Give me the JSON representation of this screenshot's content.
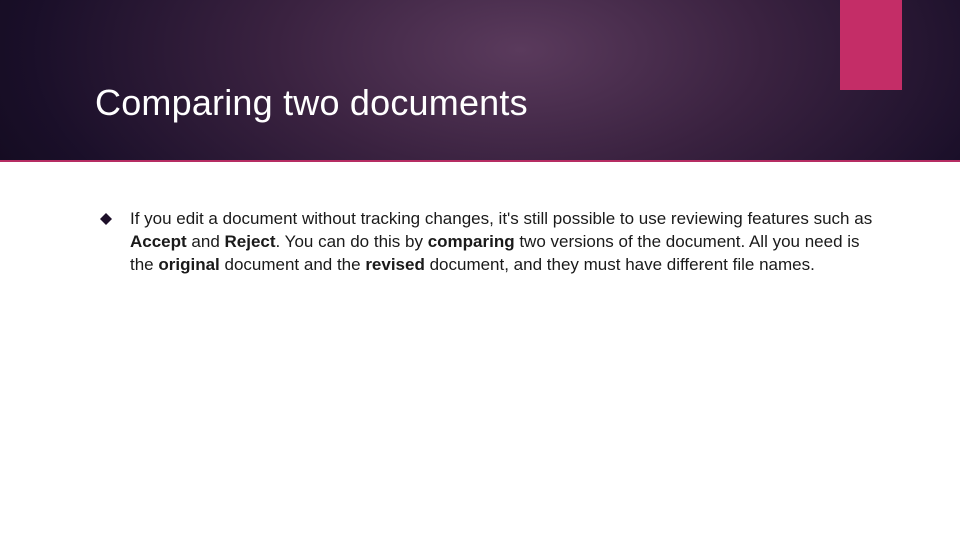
{
  "title": "Comparing two documents",
  "bullet": {
    "p1": "If you edit a document without tracking changes, it's still possible to use reviewing features such as ",
    "b1": "Accept",
    "p2": " and ",
    "b2": "Reject",
    "p3": ". You can do this by ",
    "b3": "comparing",
    "p4": " two versions of the document. All you need is the ",
    "b4": "original",
    "p5": " document and the ",
    "b5": "revised",
    "p6": " document, and they must have different file names."
  }
}
